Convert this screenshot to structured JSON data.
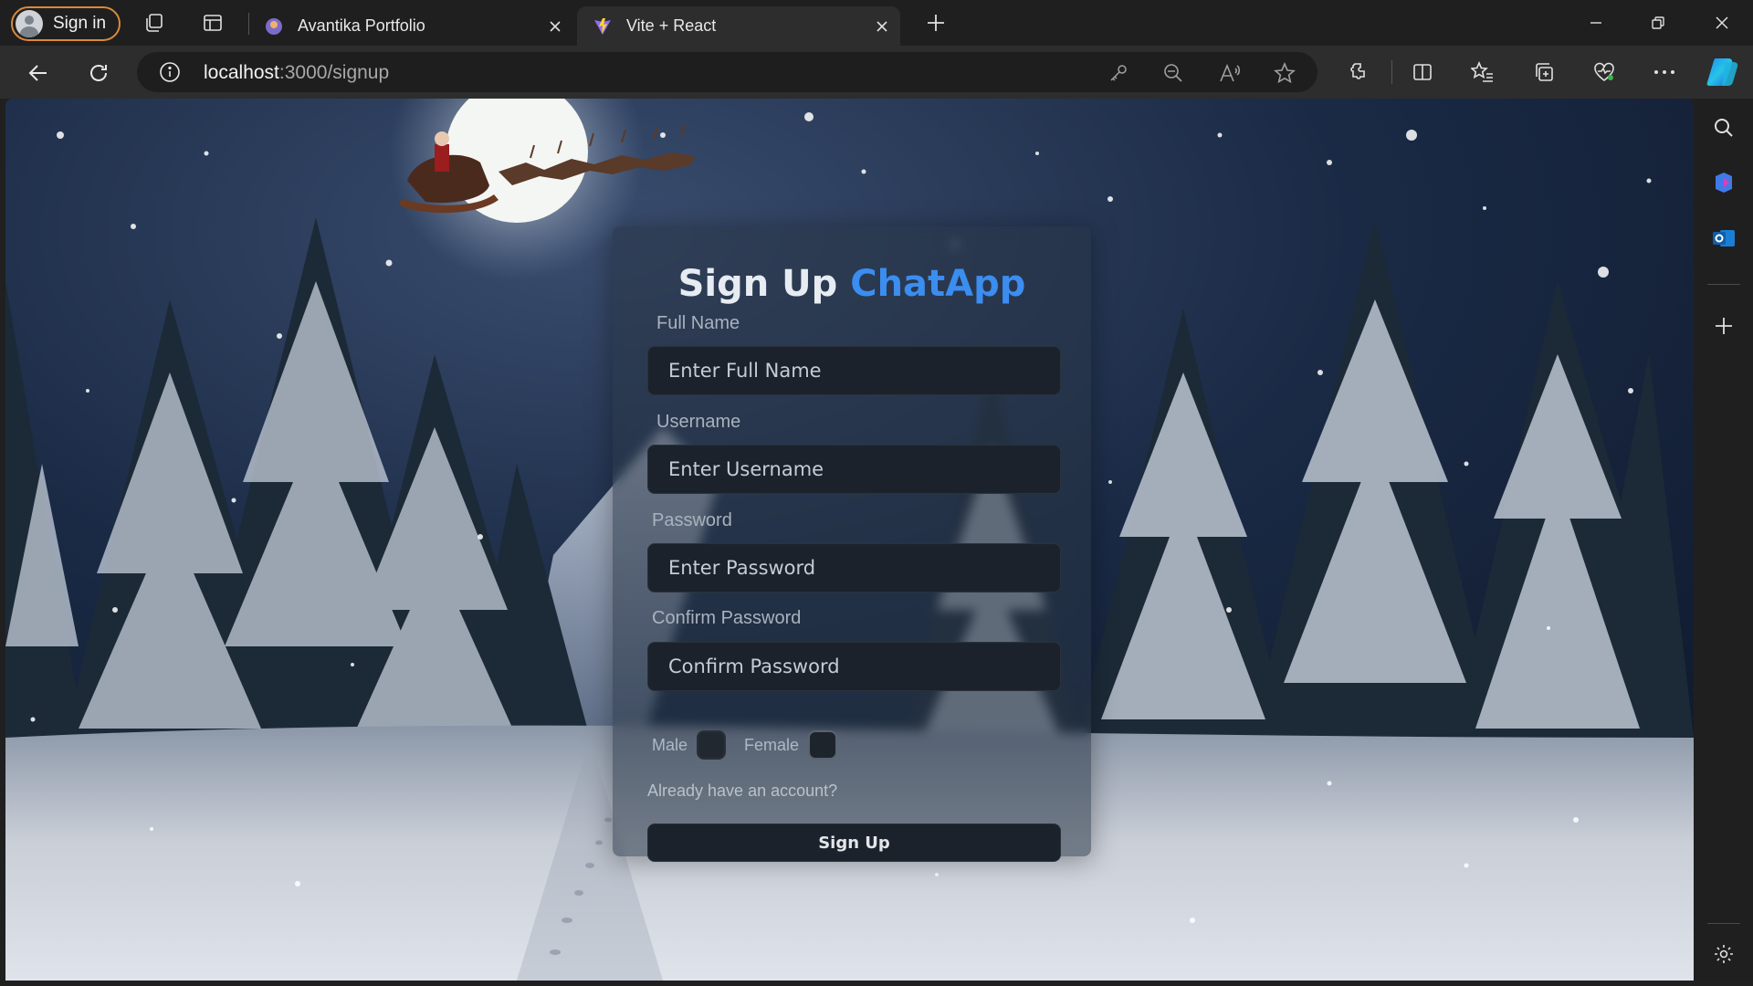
{
  "browser": {
    "signin_label": "Sign in",
    "tabs": [
      {
        "title": "Avantika Portfolio",
        "active": false
      },
      {
        "title": "Vite + React",
        "active": true
      }
    ],
    "url_host": "localhost",
    "url_path": ":3000/signup"
  },
  "form": {
    "title_prefix": "Sign Up",
    "title_brand": "ChatApp",
    "fullname_label": "Full Name",
    "fullname_placeholder": "Enter Full Name",
    "username_label": "Username",
    "username_placeholder": "Enter Username",
    "password_label": "Password",
    "password_placeholder": "Enter Password",
    "confirm_label": "Confirm Password",
    "confirm_placeholder": "Confirm Password",
    "gender_male": "Male",
    "gender_female": "Female",
    "login_link": "Already have an account?",
    "submit_label": "Sign Up"
  },
  "colors": {
    "brand": "#3b8df0",
    "signin_border": "#d98a3c",
    "card_bg": "rgba(40,52,70,0.55)",
    "input_bg": "#1c222b"
  },
  "icons": [
    "workspaces-icon",
    "vertical-tabs-icon",
    "close-icon",
    "new-tab-icon",
    "minimize-icon",
    "restore-icon",
    "back-icon",
    "refresh-icon",
    "info-icon",
    "password-key-icon",
    "zoom-out-icon",
    "read-aloud-icon",
    "favorite-star-icon",
    "extensions-icon",
    "split-screen-icon",
    "favorites-icon",
    "collections-icon",
    "browser-essentials-icon",
    "more-icon",
    "copilot-icon",
    "search-icon",
    "outlook-icon",
    "add-icon",
    "settings-icon"
  ]
}
